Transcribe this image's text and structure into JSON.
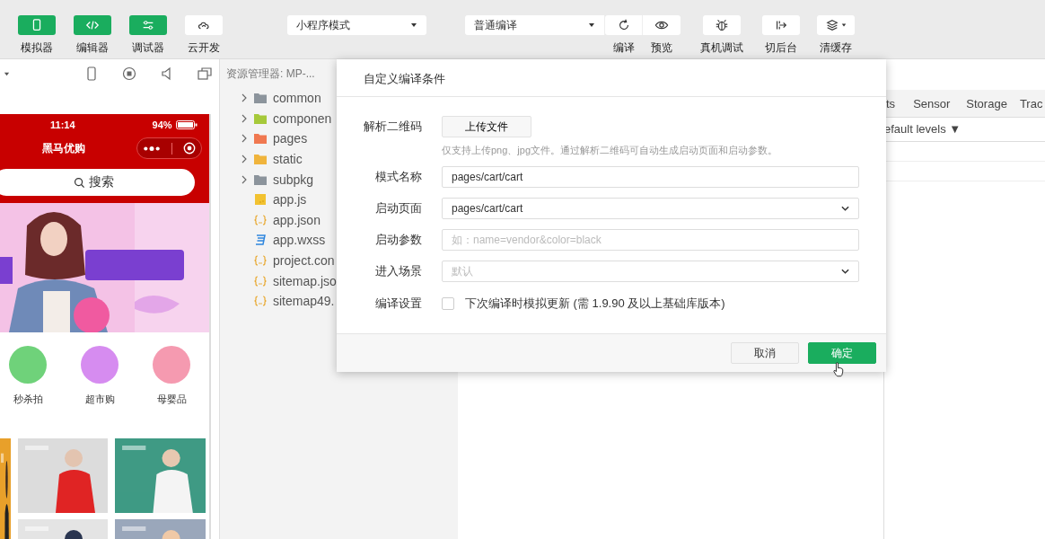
{
  "toolbar": {
    "view_toggles": [
      {
        "label": "模拟器",
        "on": true
      },
      {
        "label": "编辑器",
        "on": true
      },
      {
        "label": "调试器",
        "on": true
      },
      {
        "label": "云开发",
        "on": false
      }
    ],
    "mode_select": "小程序模式",
    "compile_select": "普通编译",
    "actions": [
      {
        "label": "编译"
      },
      {
        "label": "预览"
      }
    ],
    "tools": [
      {
        "label": "真机调试"
      },
      {
        "label": "切后台"
      },
      {
        "label": "清缓存"
      }
    ]
  },
  "simulator": {
    "time": "11:14",
    "battery": "94%",
    "title": "黑马优购",
    "search": "搜索",
    "categories": [
      {
        "label": "秒杀拍",
        "color": "#6fd27a"
      },
      {
        "label": "超市购",
        "color": "#d68cf0"
      },
      {
        "label": "母婴品",
        "color": "#f59ab0"
      }
    ]
  },
  "explorer": {
    "title": "资源管理器: MP-...",
    "items": [
      {
        "name": "common",
        "kind": "folder",
        "color": "#8c949c"
      },
      {
        "name": "componen",
        "kind": "folder",
        "color": "#a6c93a"
      },
      {
        "name": "pages",
        "kind": "folder",
        "color": "#f07850"
      },
      {
        "name": "static",
        "kind": "folder",
        "color": "#f0b43c"
      },
      {
        "name": "subpkg",
        "kind": "folder",
        "color": "#8c949c"
      },
      {
        "name": "app.js",
        "kind": "js"
      },
      {
        "name": "app.json",
        "kind": "json"
      },
      {
        "name": "app.wxss",
        "kind": "css"
      },
      {
        "name": "project.con",
        "kind": "json"
      },
      {
        "name": "sitemap.jso",
        "kind": "json"
      },
      {
        "name": "sitemap49.",
        "kind": "json"
      }
    ]
  },
  "debugger": {
    "tabs": [
      {
        "label": "ts"
      },
      {
        "label": "Sensor"
      },
      {
        "label": "Storage"
      },
      {
        "label": "Trac"
      }
    ],
    "level_filter": "efault levels ▼"
  },
  "dialog": {
    "title": "自定义编译条件",
    "qr": {
      "label": "解析二维码",
      "button": "上传文件",
      "hint": "仅支持上传png、jpg文件。通过解析二维码可自动生成启动页面和启动参数。"
    },
    "fields": [
      {
        "label": "模式名称",
        "kind": "input",
        "value": "pages/cart/cart"
      },
      {
        "label": "启动页面",
        "kind": "select",
        "value": "pages/cart/cart"
      },
      {
        "label": "启动参数",
        "kind": "input",
        "placeholder": "如：name=vendor&color=black"
      },
      {
        "label": "进入场景",
        "kind": "select",
        "placeholder": "默认"
      }
    ],
    "compile_setting": {
      "label": "编译设置",
      "checked": false,
      "text": "下次编译时模拟更新 (需 1.9.90 及以上基础库版本)"
    },
    "buttons": [
      {
        "label": "取消",
        "primary": false
      },
      {
        "label": "确定",
        "primary": true
      }
    ]
  }
}
